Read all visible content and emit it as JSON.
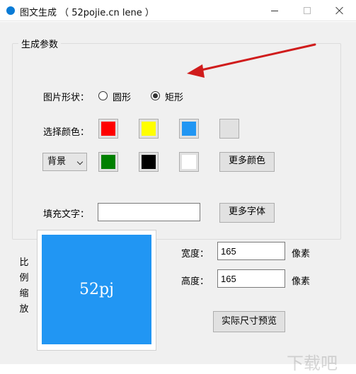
{
  "window": {
    "title": "图文生成 （ 52pojie.cn lene ）"
  },
  "group": {
    "title": "生成参数"
  },
  "shape": {
    "label": "图片形状：",
    "options": [
      {
        "label": "圆形",
        "selected": false
      },
      {
        "label": "矩形",
        "selected": true
      }
    ]
  },
  "colors": {
    "label": "选择颜色：",
    "row1": [
      "#ff0000",
      "#ffff00",
      "#2196f3",
      "#e1e1e1"
    ],
    "row2": [
      "#008000",
      "#000000",
      "#ffffff"
    ],
    "more_colors_label": "更多颜色",
    "target_selected": "背景"
  },
  "text": {
    "label": "填充文字：",
    "value": "",
    "more_fonts_label": "更多字体"
  },
  "preview": {
    "vertical_label": [
      "比",
      "例",
      "缩",
      "放"
    ],
    "sample_text": "52pj",
    "background": "#2196f3",
    "text_color": "#ffffff"
  },
  "size": {
    "width_label": "宽度：",
    "width_value": "165",
    "height_label": "高度：",
    "height_value": "165",
    "unit": "像素",
    "actual_preview_label": "实际尺寸预览"
  },
  "annotation": {
    "arrow_color": "#d01c1c"
  },
  "watermark": {
    "text": "下载吧"
  }
}
